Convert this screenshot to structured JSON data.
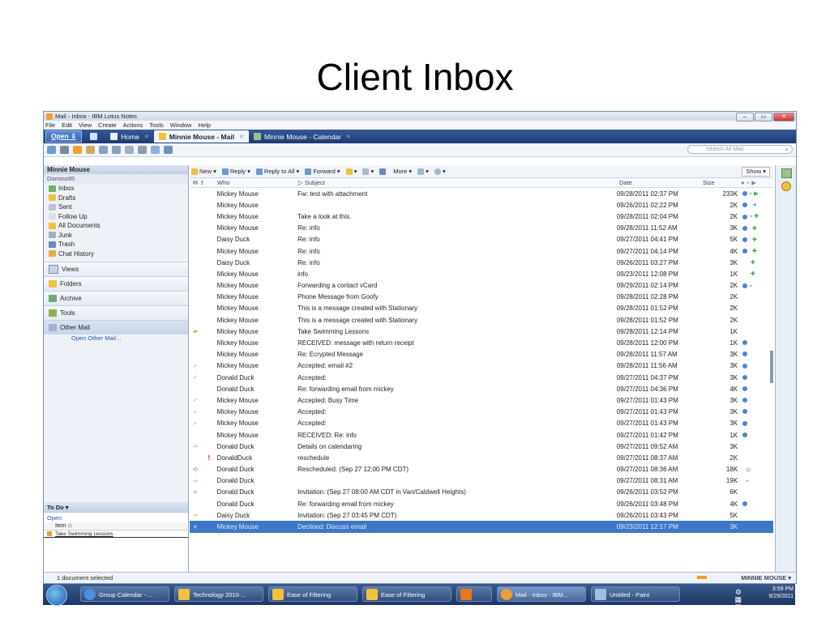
{
  "slide": {
    "title": "Client Inbox"
  },
  "window": {
    "title": "Mail - Inbox - IBM Lotus Notes",
    "menu": [
      "File",
      "Edit",
      "View",
      "Create",
      "Actions",
      "Tools",
      "Window",
      "Help"
    ],
    "open_label": "Open",
    "tabs": [
      {
        "label": "Home"
      },
      {
        "label": "Minnie Mouse - Mail"
      },
      {
        "label": "Minnie Mouse - Calendar"
      }
    ],
    "search_placeholder": "Search All Mail"
  },
  "sidebar": {
    "owner": "Minnie Mouse",
    "server": "Domino85",
    "items": [
      {
        "label": "Inbox"
      },
      {
        "label": "Drafts"
      },
      {
        "label": "Sent"
      },
      {
        "label": "Follow Up"
      },
      {
        "label": "All Documents"
      },
      {
        "label": "Junk"
      },
      {
        "label": "Trash"
      },
      {
        "label": "Chat History"
      }
    ],
    "sections": [
      {
        "label": "Views"
      },
      {
        "label": "Folders"
      },
      {
        "label": "Archive"
      },
      {
        "label": "Tools"
      },
      {
        "label": "Other Mail"
      }
    ],
    "open_other": "Open Other Mail...",
    "todo": {
      "title": "To Do",
      "open_label": "Open",
      "column": "Item",
      "item": "Take Swimming Lessons"
    }
  },
  "actions": [
    "New",
    "Reply",
    "Reply to All",
    "Forward",
    "More"
  ],
  "show_label": "Show",
  "columns": {
    "who": "Who",
    "subject": "Subject",
    "date": "Date",
    "size": "Size"
  },
  "messages": [
    {
      "who": "Mickey Mouse",
      "subject": "Fw: test with attachment",
      "date": "09/28/2011 02:37 PM",
      "size": "233K"
    },
    {
      "who": "Mickey Mouse",
      "subject": "",
      "date": "09/26/2011 02:22 PM",
      "size": "2K"
    },
    {
      "who": "Mickey Mouse",
      "subject": "Take a look at this.",
      "date": "09/28/2011 02:04 PM",
      "size": "2K"
    },
    {
      "who": "Mickey Mouse",
      "subject": "Re: info",
      "date": "09/28/2011 11:52 AM",
      "size": "3K"
    },
    {
      "who": "Daisy Duck",
      "subject": "Re: info",
      "date": "09/27/2011 04:41 PM",
      "size": "5K"
    },
    {
      "who": "Mickey Mouse",
      "subject": "Re: info",
      "date": "09/27/2011 04:14 PM",
      "size": "4K"
    },
    {
      "who": "Daisy Duck",
      "subject": "Re: info",
      "date": "09/26/2011 03:27 PM",
      "size": "3K"
    },
    {
      "who": "Mickey Mouse",
      "subject": "info",
      "date": "09/23/2011 12:08 PM",
      "size": "1K"
    },
    {
      "who": "Mickey Mouse",
      "subject": "Forwarding a contact vCard",
      "date": "09/29/2011 02:14 PM",
      "size": "2K"
    },
    {
      "who": "Mickey Mouse",
      "subject": "Phone Message from Goofy",
      "date": "09/28/2011 02:28 PM",
      "size": "2K"
    },
    {
      "who": "Mickey Mouse",
      "subject": "This is a message created with Stationary",
      "date": "09/28/2011 01:52 PM",
      "size": "2K"
    },
    {
      "who": "Mickey Mouse",
      "subject": "This is a message created with Stationary",
      "date": "09/28/2011 01:52 PM",
      "size": "2K"
    },
    {
      "who": "Mickey Mouse",
      "subject": "Take Swimming Lessons",
      "date": "09/28/2011 12:14 PM",
      "size": "1K"
    },
    {
      "who": "Mickey Mouse",
      "subject": "RECEIVED: message with return receipt",
      "date": "09/28/2011 12:00 PM",
      "size": "1K"
    },
    {
      "who": "Mickey Mouse",
      "subject": "Re: Ecrypted Message",
      "date": "09/28/2011 11:57 AM",
      "size": "3K"
    },
    {
      "who": "Mickey Mouse",
      "subject": "Accepted: email #2",
      "date": "09/28/2011 11:56 AM",
      "size": "3K"
    },
    {
      "who": "Donald Duck",
      "subject": "Accepted:",
      "date": "09/27/2011 04:37 PM",
      "size": "3K"
    },
    {
      "who": "Donald Duck",
      "subject": "Re: forwarding email from mickey",
      "date": "09/27/2011 04:36 PM",
      "size": "4K"
    },
    {
      "who": "Mickey Mouse",
      "subject": "Accepted: Busy Time",
      "date": "09/27/2011 01:43 PM",
      "size": "3K"
    },
    {
      "who": "Mickey Mouse",
      "subject": "Accepted:",
      "date": "09/27/2011 01:43 PM",
      "size": "3K"
    },
    {
      "who": "Mickey Mouse",
      "subject": "Accepted:",
      "date": "09/27/2011 01:43 PM",
      "size": "3K"
    },
    {
      "who": "Mickey Mouse",
      "subject": "RECEIVED: Re: info",
      "date": "09/27/2011 01:42 PM",
      "size": "1K"
    },
    {
      "who": "Donald Duck",
      "subject": "Details on calendaring",
      "date": "09/27/2011 09:52 AM",
      "size": "3K"
    },
    {
      "who": "DonaldDuck",
      "subject": "reschedule",
      "date": "09/27/2011 08:37 AM",
      "size": "2K"
    },
    {
      "who": "Donald Duck",
      "subject": "Rescheduled:  (Sep 27 12:00 PM CDT)",
      "date": "09/27/2011 08:36 AM",
      "size": "18K"
    },
    {
      "who": "Donald Duck",
      "subject": "",
      "date": "09/27/2011 08:31 AM",
      "size": "19K"
    },
    {
      "who": "Donald Duck",
      "subject": "Invitation:  (Sep 27 08:00 AM CDT in Van/Caldwell Heights)",
      "date": "09/26/2011 03:52 PM",
      "size": "6K"
    },
    {
      "who": "Donald Duck",
      "subject": "Re: forwarding email from mickey",
      "date": "09/26/2011 03:48 PM",
      "size": "4K"
    },
    {
      "who": "Daisy Duck",
      "subject": "Invitation:  (Sep 27 03:45 PM CDT)",
      "date": "09/26/2011 03:43 PM",
      "size": "5K"
    },
    {
      "who": "Mickey Mouse",
      "subject": "Declined: Discuss email",
      "date": "09/23/2011 12:17 PM",
      "size": "3K"
    }
  ],
  "status": {
    "left": "1 document selected",
    "user": "MINNIE MOUSE"
  },
  "taskbar": {
    "items": [
      {
        "label": "Group Calendar - ..."
      },
      {
        "label": "Technology 2010-..."
      },
      {
        "label": "Ease of Filtering"
      },
      {
        "label": "Ease of Filtering"
      },
      {
        "label": ""
      },
      {
        "label": "Mail - Inbox - IBM..."
      },
      {
        "label": "Untitled - Paint"
      }
    ],
    "time": "3:59 PM",
    "date": "9/29/2011"
  }
}
